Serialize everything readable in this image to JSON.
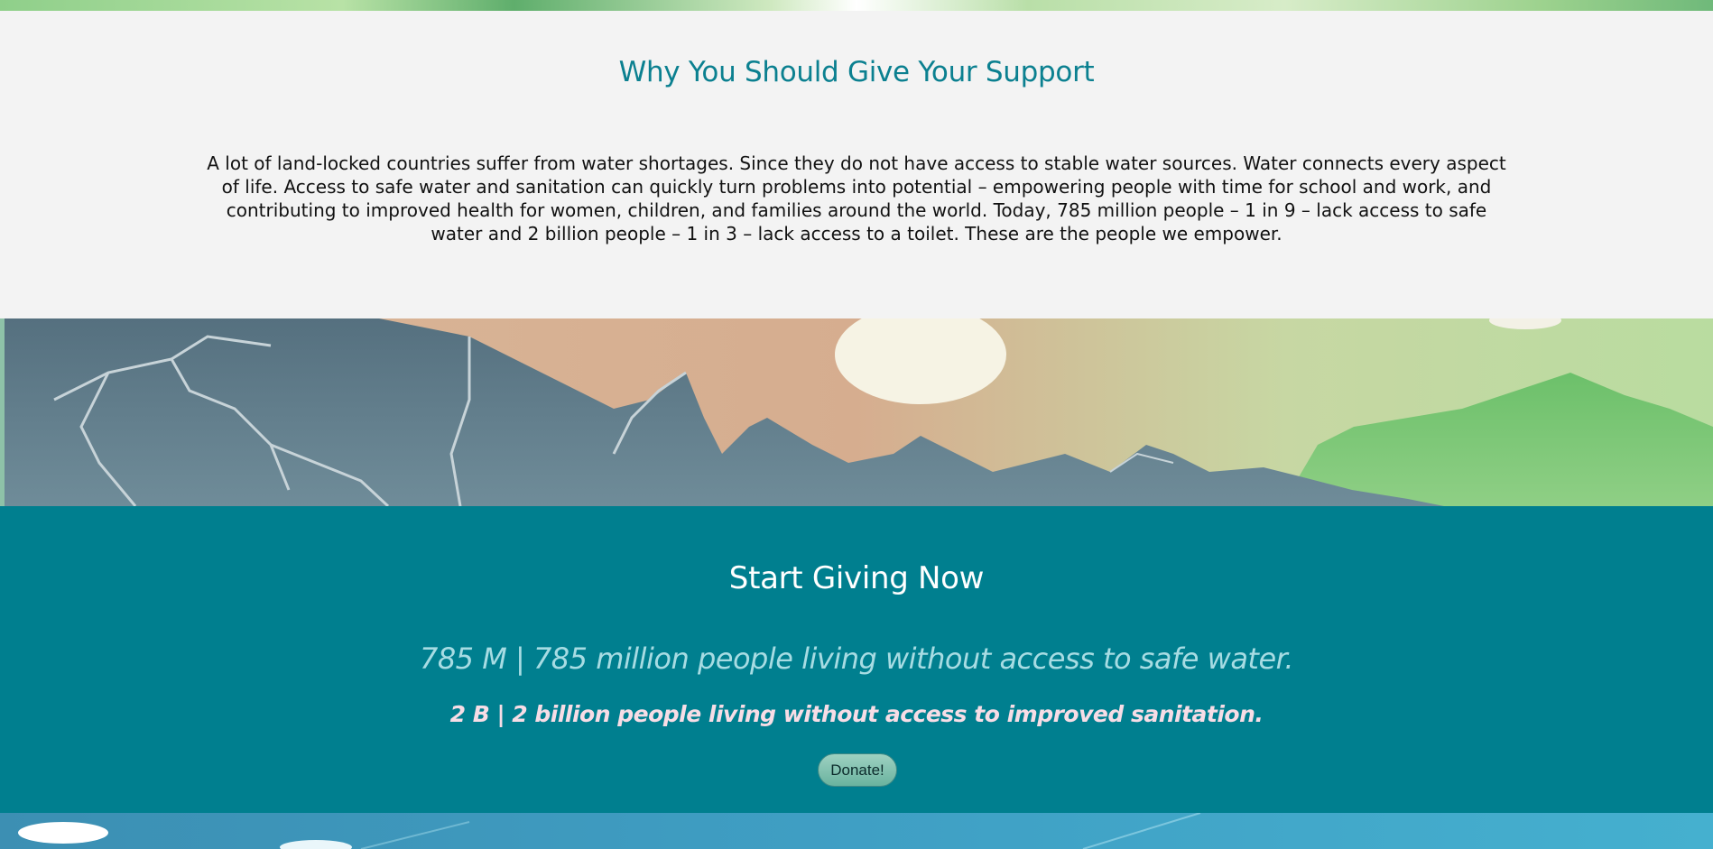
{
  "support": {
    "title": "Why You Should Give Your Support",
    "paragraph": "A lot of land-locked countries suffer from water shortages. Since they do not have access to stable water sources. Water connects every aspect of life. Access to safe water and sanitation can quickly turn problems into potential – empowering people with time for school and work, and contributing to improved health for women, children, and families around the world. Today, 785 million people – 1 in 9 – lack access to safe water and 2 billion people – 1 in 3 – lack access to a toilet. These are the people we empower."
  },
  "giving": {
    "title": "Start Giving Now",
    "stat_water": "785 M | 785 million people living without access to safe water.",
    "stat_sanitation": "2 B | 2 billion people living without access to improved sanitation.",
    "donate_label": "Donate!"
  },
  "colors": {
    "heading_teal": "#0b8090",
    "section_teal": "#007f8f",
    "stat_water_color": "#a7dce3",
    "stat_sanitation_color": "#f7dde6",
    "donate_button": "#7fc1ad"
  }
}
